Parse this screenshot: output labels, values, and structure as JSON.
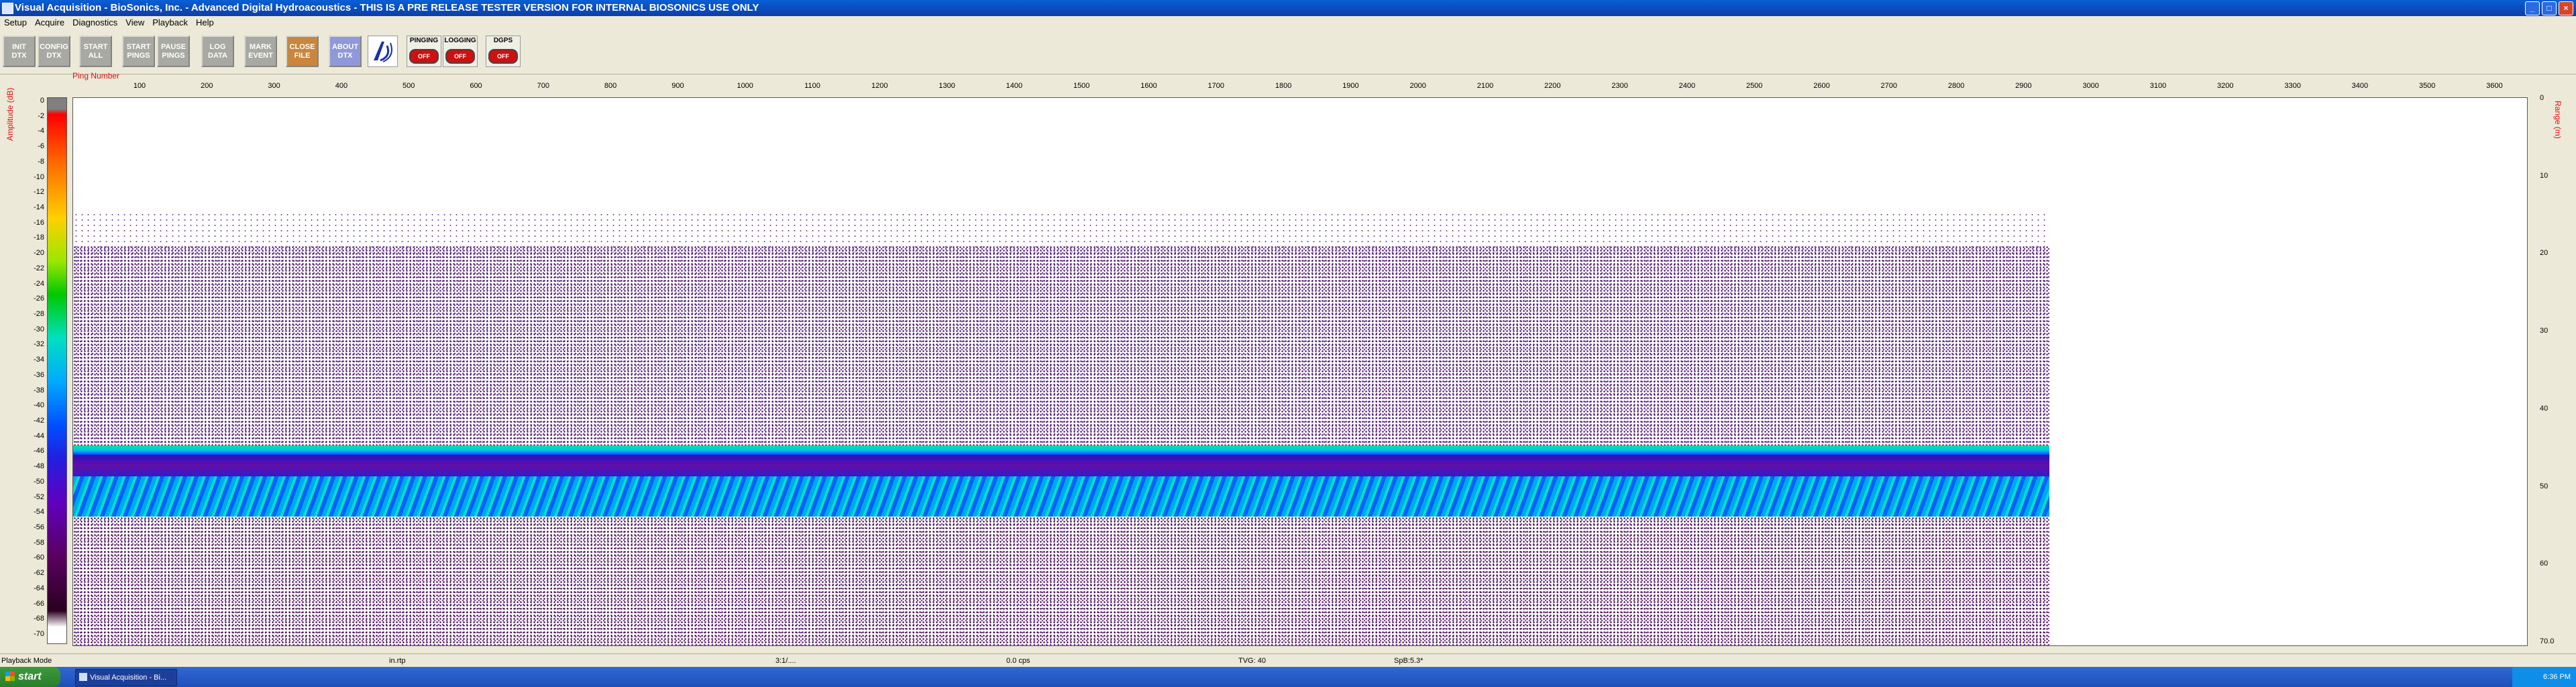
{
  "window": {
    "title": "Visual Acquisition - BioSonics, Inc. - Advanced Digital Hydroacoustics - THIS IS A PRE RELEASE TESTER VERSION FOR INTERNAL BIOSONICS USE ONLY",
    "buttons": [
      "_",
      "□",
      "×"
    ]
  },
  "menu": [
    "Setup",
    "Acquire",
    "Diagnostics",
    "View",
    "Playback",
    "Help"
  ],
  "toolbar": {
    "buttons": [
      "INIT\nDTX",
      "CONFIG\nDTX",
      "START\nALL",
      "START\nPINGS",
      "PAUSE\nPINGS",
      "LOG\nDATA",
      "MARK\nEVENT",
      "CLOSE\nFILE",
      "ABOUT\nDTX"
    ],
    "status": [
      {
        "label": "PINGING",
        "state": "OFF"
      },
      {
        "label": "LOGGING",
        "state": "OFF"
      },
      {
        "label": "DGPS",
        "state": "OFF"
      }
    ]
  },
  "echogram": {
    "ping_label": "Ping Number",
    "amp_label": "Amplitude (dB)",
    "range_label": "Range (m)",
    "amp_ticks": [
      "0",
      "-2",
      "-4",
      "-6",
      "-8",
      "-10",
      "-12",
      "-14",
      "-16",
      "-18",
      "-20",
      "-22",
      "-24",
      "-26",
      "-28",
      "-30",
      "-32",
      "-34",
      "-36",
      "-38",
      "-40",
      "-42",
      "-44",
      "-46",
      "-48",
      "-50",
      "-52",
      "-54",
      "-56",
      "-58",
      "-60",
      "-62",
      "-64",
      "-66",
      "-68",
      "-70"
    ],
    "ping_ticks": [
      "100",
      "200",
      "300",
      "400",
      "500",
      "600",
      "700",
      "800",
      "900",
      "1000",
      "1100",
      "1200",
      "1300",
      "1400",
      "1500",
      "1600",
      "1700",
      "1800",
      "1900",
      "2000",
      "2100",
      "2200",
      "2300",
      "2400",
      "2500",
      "2600",
      "2700",
      "2800",
      "2900",
      "3000",
      "3100",
      "3200",
      "3300",
      "3400",
      "3500",
      "3600"
    ],
    "range_ticks": [
      "0",
      "10",
      "20",
      "30",
      "40",
      "50",
      "60",
      "70.0"
    ]
  },
  "statusbar": {
    "mode": "Playback Mode",
    "file": "in.rtp",
    "time": "3:1/....",
    "rate": "0.0 cps",
    "tvg": "TVG: 40",
    "spb": "SpB:5.3*"
  },
  "taskbar": {
    "start": "start",
    "task": "Visual Acquisition - Bi...",
    "clock": "6:36 PM"
  },
  "colors": {
    "accent": "#e01010",
    "title": "#0b4fc8",
    "taskbar": "#2458c8"
  }
}
